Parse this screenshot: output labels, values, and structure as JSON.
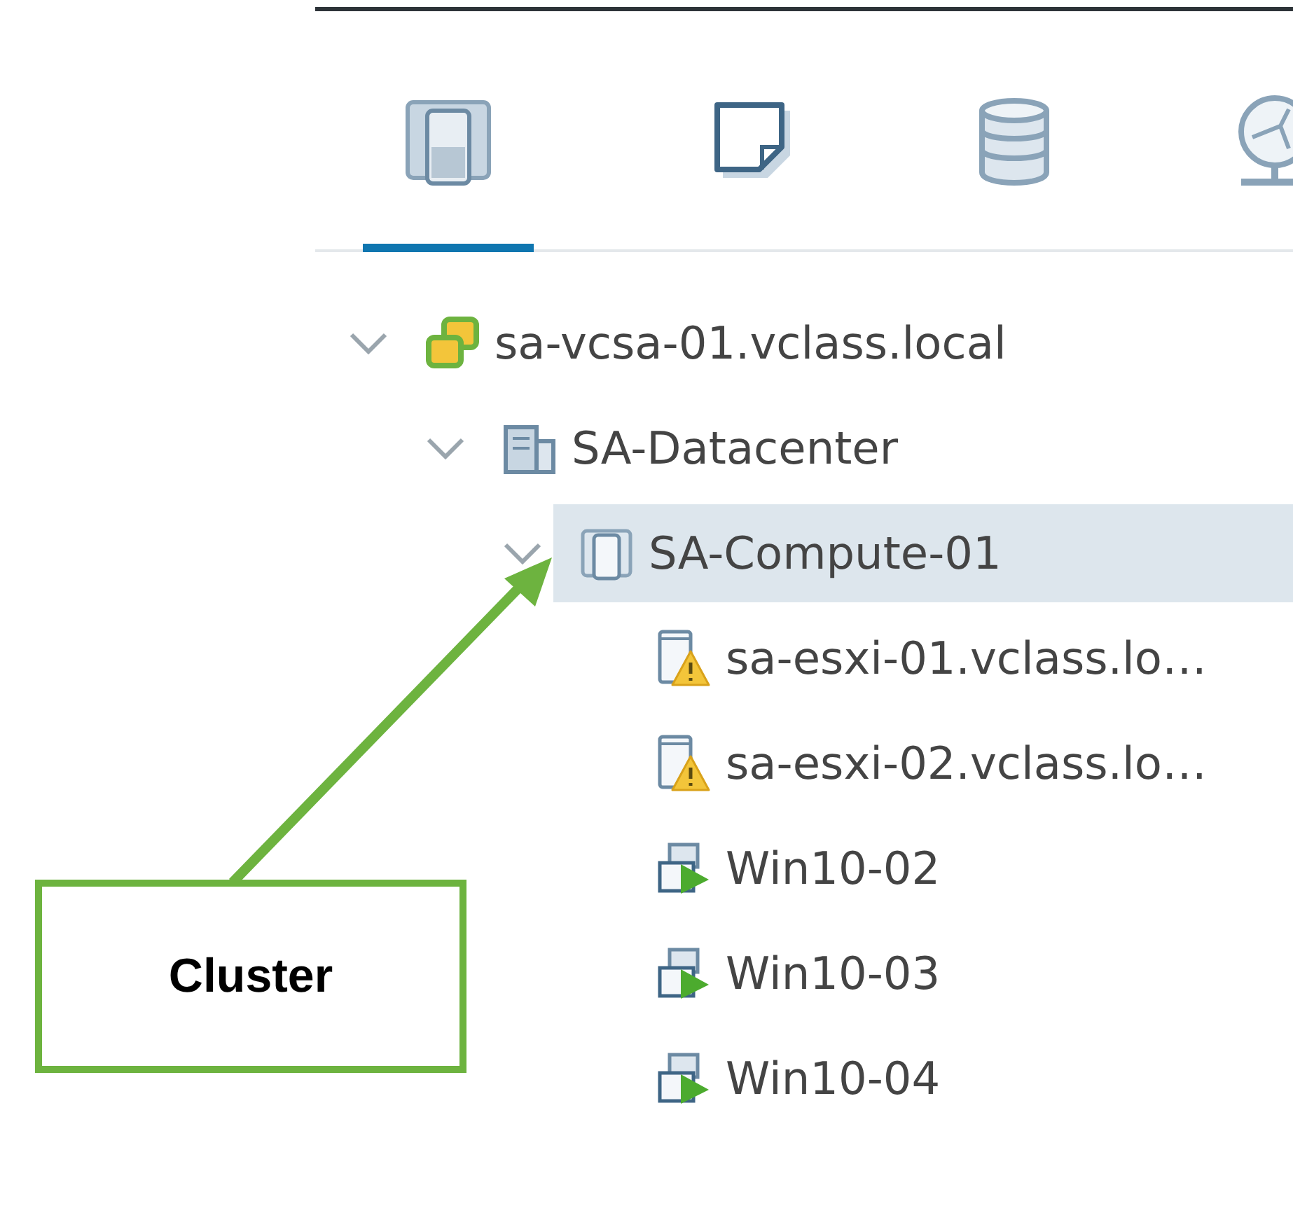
{
  "tabs": [
    {
      "kind": "hosts",
      "selected": true
    },
    {
      "kind": "vms",
      "selected": false
    },
    {
      "kind": "storage",
      "selected": false
    },
    {
      "kind": "network",
      "selected": false
    }
  ],
  "tree": [
    {
      "kind": "vcenter",
      "label": "sa-vcsa-01.vclass.local",
      "expanded": true,
      "selected": false,
      "children": [
        {
          "kind": "datacenter",
          "label": "SA-Datacenter",
          "expanded": true,
          "selected": false,
          "children": [
            {
              "kind": "cluster",
              "label": "SA-Compute-01",
              "expanded": true,
              "selected": true,
              "children": [
                {
                  "kind": "host",
                  "label": "sa-esxi-01.vclass.lo…",
                  "warning": true,
                  "selected": false
                },
                {
                  "kind": "host",
                  "label": "sa-esxi-02.vclass.lo…",
                  "warning": true,
                  "selected": false
                },
                {
                  "kind": "vm",
                  "label": "Win10-02",
                  "selected": false
                },
                {
                  "kind": "vm",
                  "label": "Win10-03",
                  "selected": false
                },
                {
                  "kind": "vm",
                  "label": "Win10-04",
                  "selected": false
                }
              ]
            }
          ]
        }
      ]
    }
  ],
  "annotation": {
    "label": "Cluster"
  }
}
